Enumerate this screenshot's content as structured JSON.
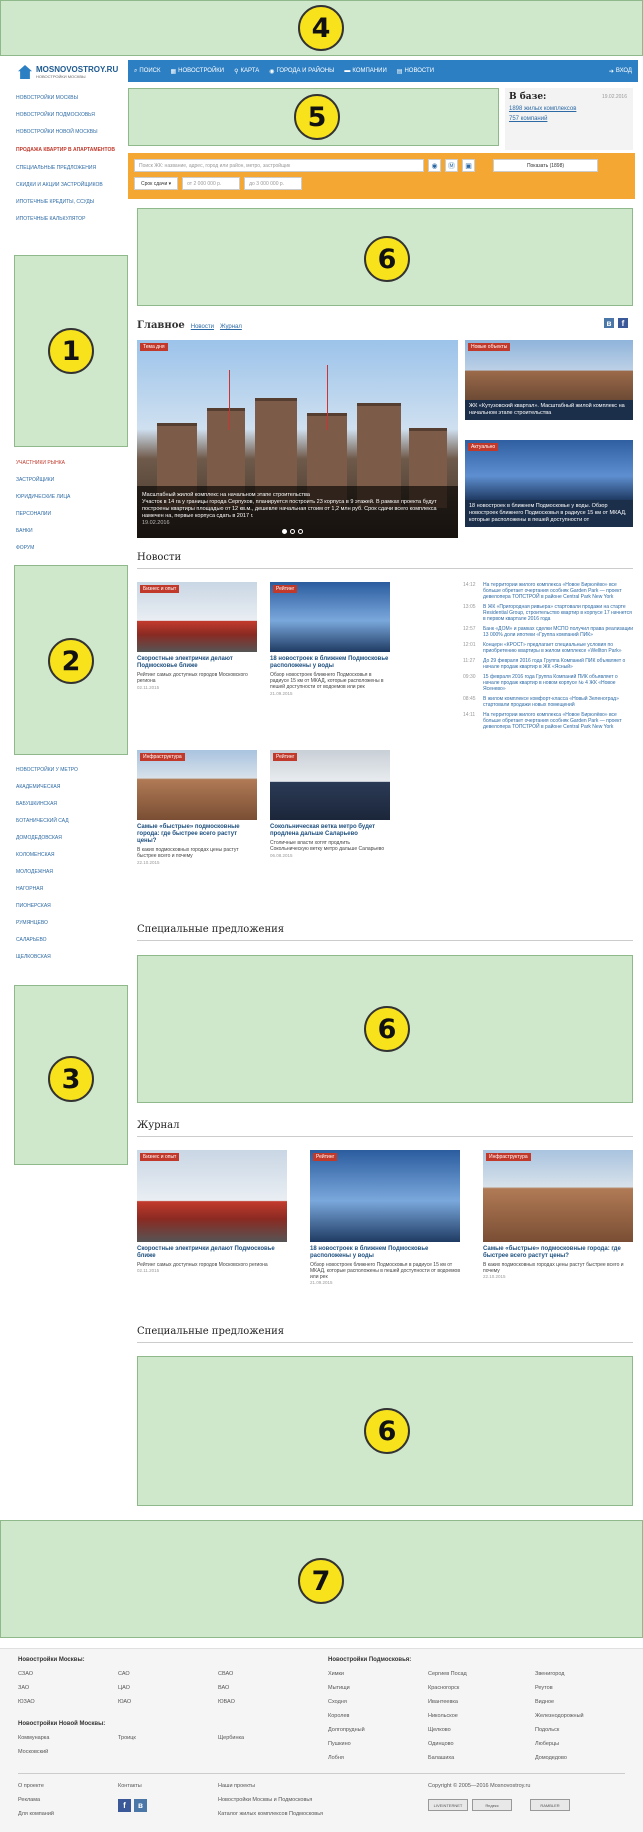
{
  "header": {
    "logo_title": "MOSNOVOSTROY.RU",
    "logo_subtitle": "НОВОСТРОЙКИ МОСКВЫ",
    "nav": [
      {
        "label": "ПОИСК",
        "icon": "search-icon"
      },
      {
        "label": "НОВОСТРОЙКИ",
        "icon": "building-icon"
      },
      {
        "label": "КАРТА",
        "icon": "map-pin-icon"
      },
      {
        "label": "ГОРОДА И РАЙОНЫ",
        "icon": "location-icon"
      },
      {
        "label": "КОМПАНИИ",
        "icon": "briefcase-icon"
      },
      {
        "label": "НОВОСТИ",
        "icon": "newspaper-icon"
      }
    ],
    "login": "ВХОД"
  },
  "zones": [
    "1",
    "2",
    "3",
    "4",
    "5",
    "6",
    "6",
    "6",
    "7"
  ],
  "stats": {
    "title": "В базе:",
    "date": "19.02.2016",
    "complexes": "1898 жилых комплексов",
    "companies": "757 компаний"
  },
  "sidebar": {
    "top": [
      "НОВОСТРОЙКИ МОСКВЫ",
      "НОВОСТРОЙКИ ПОДМОСКОВЬЯ",
      "НОВОСТРОЙКИ НОВОЙ МОСКВЫ"
    ],
    "sale_link": "ПРОДАЖА КВАРТИР В АПАРТАМЕНТОВ",
    "sale_items": [
      "СПЕЦИАЛЬНЫЕ ПРЕДЛОЖЕНИЯ",
      "СКИДКИ И АКЦИИ ЗАСТРОЙЩИКОВ",
      "ИПОТЕЧНЫЕ КРЕДИТЫ, ССУДЫ",
      "ИПОТЕЧНЫЕ КАЛЬКУЛЯТОР"
    ],
    "market": [
      "УЧАСТНИКИ РЫНКА",
      "ЗАСТРОЙЩИКИ",
      "ЮРИДИЧЕСКИЕ ЛИЦА",
      "ПЕРСОНАЛИИ",
      "БАНКИ",
      "ФОРУМ"
    ],
    "metro": [
      "НОВОСТРОЙКИ У МЕТРО",
      "АКАДЕМИЧЕСКАЯ",
      "БАБУШКИНСКАЯ",
      "БОТАНИЧЕСКИЙ САД",
      "ДОМОДЕДОВСКАЯ",
      "КОЛОМЕНСКАЯ",
      "МОЛОДЕЖНАЯ",
      "НАГОРНАЯ",
      "ПИОНЕРСКАЯ",
      "РУМЯНЦЕВО",
      "САЛАРЬЕВО",
      "ЩЕЛКОВСКАЯ"
    ]
  },
  "search": {
    "placeholder": "Поиск ЖК: название, адрес, город или район, метро, застройщик",
    "show_button": "Показать (1898)",
    "deadline": "Срок сдачи ▾",
    "price_from": "от 2 000 000 р.",
    "price_to": "до 3 000 000 р."
  },
  "tabs": {
    "main": "Главное",
    "news": "Новости",
    "journal": "Журнал"
  },
  "hero": {
    "tag": "Тема дня",
    "title": "Масштабный жилой комплекс на начальном этапе строительства",
    "text": "Участок в 14 га у границы города Серпухов, планируется построить 23 корпуса в 9 этажей. В рамках проекта будут построены квартиры площадью от 12 кв.м., дешевле начальная стоим от 1,2 млн руб. Срок сдачи всего комплекса намечен на, первые корпуса сдать в 2017 г.",
    "date": "19.02.2016"
  },
  "side_cards": [
    {
      "tag": "Новые объекты",
      "title": "ЖК «Кутузовский квартал». Масштабный жилой комплекс на начальном этапе строительства"
    },
    {
      "tag": "Актуально",
      "title": "18 новостроек в ближнем Подмосковье у воды. Обзор новостроек ближнего Подмосковья в радиусе 15 км от МКАД, которые расположены в пешей доступности от"
    }
  ],
  "sections": {
    "news": "Новости",
    "special": "Специальные предложения",
    "journal": "Журнал"
  },
  "news_cards": [
    {
      "tag": "Бизнес и опыт",
      "title": "Скоростные электрички делают Подмосковье ближе",
      "text": "Рейтинг самых доступных городов Московского региона",
      "date": "02.11.2015"
    },
    {
      "tag": "Рейтинг",
      "title": "18 новостроек в ближнем Подмосковье расположены у воды",
      "text": "Обзор новостроек ближнего Подмосковья в радиусе 15 км от МКАД, которые расположены в пешей доступности от водоемов или рек",
      "date": "21.09.2015"
    },
    {
      "tag": "Инфраструктура",
      "title": "Самые «быстрые» подмосковные города: где быстрее всего растут цены?",
      "text": "В каких подмосковных городах цены растут быстрее всего и почему",
      "date": "22.10.2015"
    },
    {
      "tag": "Рейтинг",
      "title": "Сокольническая ветка метро будет продлена дальше Саларьево",
      "text": "Столичные власти хотят продлить Сокольническую ветку метро дальше Саларьево",
      "date": "06.08.2015"
    }
  ],
  "news_list": [
    {
      "time": "14:12",
      "text": "На территории жилого комплекса «Новое Бирюлёво» все больше обретает очертания особняк Garden Park — проект девелопера ТОПСТРОЙ в районе Central Park New York"
    },
    {
      "time": "13:05",
      "text": "В ЖК «Пригородная ривьера» стартовали продажи на старте Residential Group, строительство квартир в корпусе 17 начнется в первом квартале 2016 года"
    },
    {
      "time": "12:57",
      "text": "Банк «ДОМ» и рамках сделки МСПО получил права реализации 13 000% доли ипотеки «Группа компаний ПИК»"
    },
    {
      "time": "12:01",
      "text": "Концерн «КРОСТ» предлагает специальные условия по приобретению квартиры в жилом комплексе «Wellton Park»"
    },
    {
      "time": "11:27",
      "text": "До 29 февраля 2016 года Группа Компаний ПИК объявляет о начале продаж квартир в ЖК «Ясный»"
    },
    {
      "time": "09:30",
      "text": "15 февраля 2016 года Группа Компаний ПИК объявляет о начале продаж квартир в новом корпусе № 4 ЖК «Новое Ясенево»"
    },
    {
      "time": "08:45",
      "text": "В жилом комплексе комфорт-класса «Новый Зеленоград» стартовали продажи новых помещений"
    },
    {
      "time": "14:11",
      "text": "На территории жилого комплекса «Новое Бирюлёво» все больше обретает очертания особняк Garden Park — проект девелопера ТОПСТРОЙ в районе Central Park New York"
    }
  ],
  "journal_cards": [
    {
      "tag": "Бизнес и опыт",
      "title": "Скоростные электрички делают Подмосковье ближе",
      "text": "Рейтинг самых доступных городов Московского региона",
      "date": "02.11.2015"
    },
    {
      "tag": "Рейтинг",
      "title": "18 новостроек в ближнем Подмосковье расположены у воды",
      "text": "Обзор новостроек ближнего Подмосковья в радиусе 15 км от МКАД, которые расположены в пешей доступности от водоемов или рек",
      "date": "21.09.2015"
    },
    {
      "tag": "Инфраструктура",
      "title": "Самые «быстрые» подмосковные города: где быстрее всего растут цены?",
      "text": "В каких подмосковных городах цены растут быстрее всего и почему",
      "date": "22.10.2015"
    }
  ],
  "footer": {
    "moscow_head": "Новостройки Москвы:",
    "moscow": [
      "СЗАО",
      "САО",
      "СВАО",
      "ЗАО",
      "ЦАО",
      "ВАО",
      "ЮЗАО",
      "ЮАО",
      "ЮВАО"
    ],
    "region_head": "Новостройки Подмосковья:",
    "region": [
      "Химки",
      "Сергиев Посад",
      "Звенигород",
      "Мытищи",
      "Красногорск",
      "Реутов",
      "Сходня",
      "Ивантеевка",
      "Видное",
      "Королев",
      "Никольское",
      "Железнодорожный",
      "Долгопрудный",
      "Щелково",
      "Подольск",
      "Пушкино",
      "Одинцово",
      "Люберцы",
      "Лобня",
      "Балашиха",
      "Домодедово"
    ],
    "new_moscow_head": "Новостройки Новой Москвы:",
    "new_moscow": [
      "Коммунарка",
      "Троицк",
      "Щербинка",
      "Московский"
    ],
    "about": "О проекте",
    "contacts": "Контакты",
    "ads": "Реклама",
    "for_builders": "Для компаний",
    "our_projects": "Наши проекты",
    "project1": "Новостройки Москвы и Подмосковья",
    "project2": "Каталог жилых комплексов Подмосковья",
    "copyright": "Copyright © 2005—2016 Mosnovostroy.ru",
    "counters": [
      "LIVEINTERNET",
      "Яндекс",
      "RAMBLER"
    ]
  }
}
